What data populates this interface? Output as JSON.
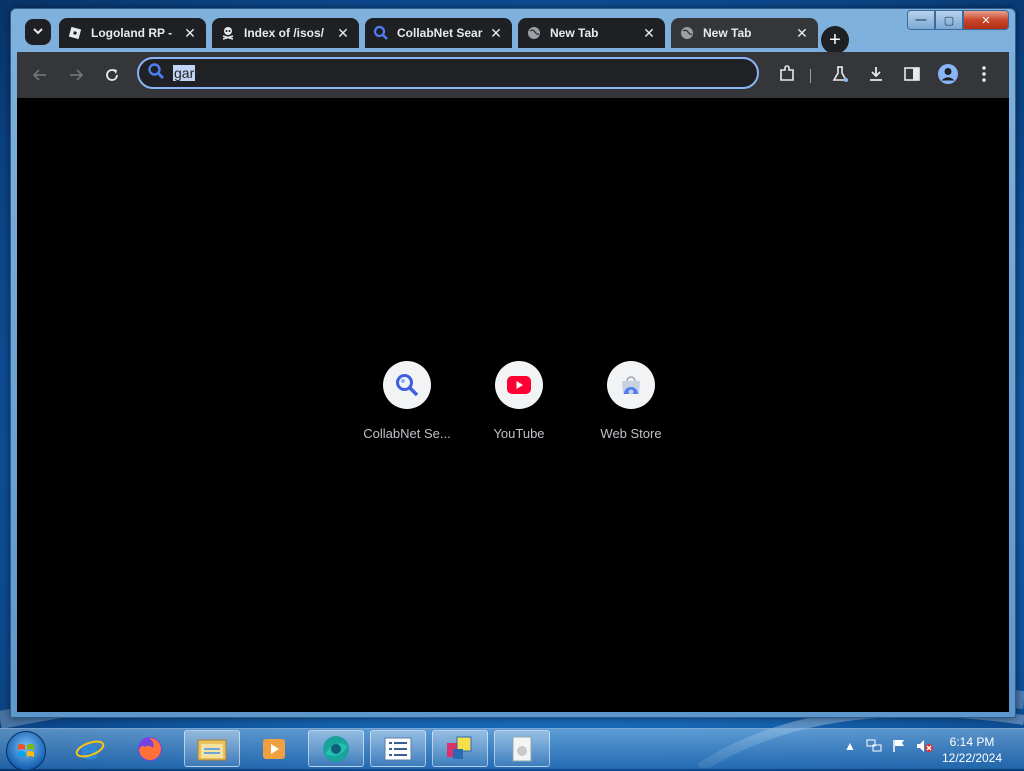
{
  "tabs": [
    {
      "title": "Logoland RP -",
      "favicon": "roblox-icon"
    },
    {
      "title": "Index of /isos/",
      "favicon": "pirate-icon"
    },
    {
      "title": "CollabNet Sear",
      "favicon": "search-icon"
    },
    {
      "title": "New Tab",
      "favicon": "globe-icon"
    },
    {
      "title": "New Tab",
      "favicon": "globe-icon",
      "active": true
    }
  ],
  "omnibox": {
    "value": "gar"
  },
  "shortcuts": [
    {
      "label": "CollabNet Se...",
      "icon": "search-icon"
    },
    {
      "label": "YouTube",
      "icon": "youtube-icon"
    },
    {
      "label": "Web Store",
      "icon": "web-store-icon"
    }
  ],
  "taskbar": {
    "clock_time": "6:14 PM",
    "clock_date": "12/22/2024"
  },
  "colors": {
    "tab_active": "#35363a",
    "tab_inactive": "#1f2023",
    "omnibox_border": "#8ab4f8",
    "content_bg": "#000000",
    "youtube_red": "#ff0033"
  }
}
